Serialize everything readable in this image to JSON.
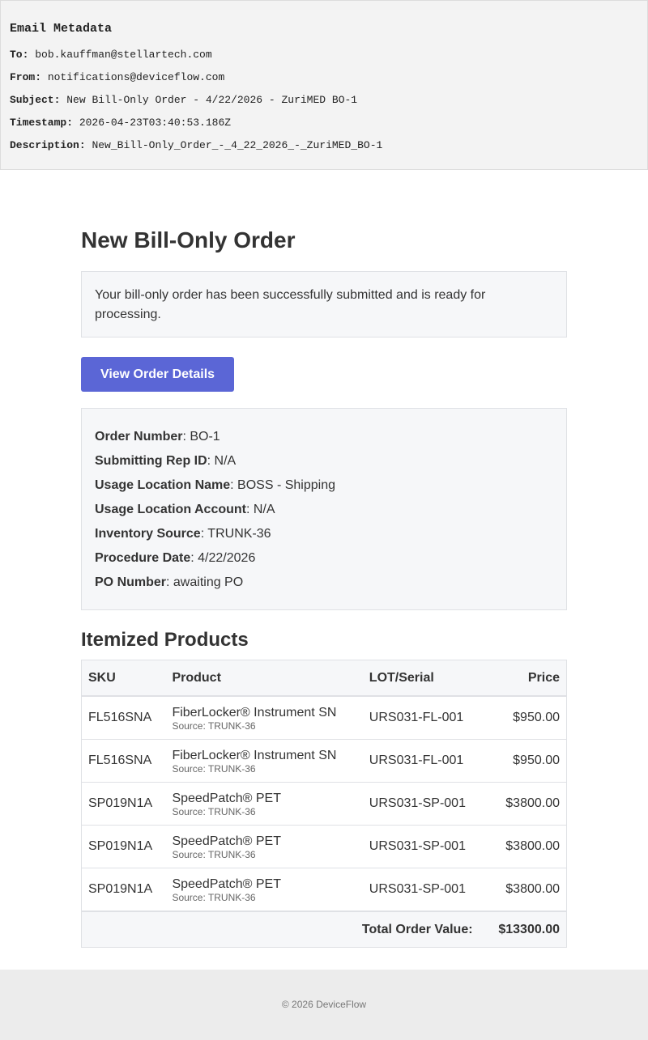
{
  "metadata": {
    "title": "Email Metadata",
    "to_label": "To:",
    "to": "bob.kauffman@stellartech.com",
    "from_label": "From:",
    "from": "notifications@deviceflow.com",
    "subject_label": "Subject:",
    "subject": "New Bill-Only Order - 4/22/2026 - ZuriMED BO-1",
    "timestamp_label": "Timestamp:",
    "timestamp": "2026-04-23T03:40:53.186Z",
    "description_label": "Description:",
    "description": "New_Bill-Only_Order_-_4_22_2026_-_ZuriMED_BO-1"
  },
  "email": {
    "heading": "New Bill-Only Order",
    "notice": "Your bill-only order has been successfully submitted and is ready for processing.",
    "button_label": "View Order Details",
    "details": [
      {
        "label": "Order Number",
        "value": ": BO-1"
      },
      {
        "label": "Submitting Rep ID",
        "value": ": N/A"
      },
      {
        "label": "Usage Location Name",
        "value": ": BOSS - Shipping"
      },
      {
        "label": "Usage Location Account",
        "value": ": N/A"
      },
      {
        "label": "Inventory Source",
        "value": ": TRUNK-36"
      },
      {
        "label": "Procedure Date",
        "value": ": 4/22/2026"
      },
      {
        "label": "PO Number",
        "value": ": awaiting PO"
      }
    ],
    "products_heading": "Itemized Products",
    "table": {
      "headers": [
        "SKU",
        "Product",
        "LOT/Serial",
        "Price"
      ],
      "rows": [
        {
          "sku": "FL516SNA",
          "product": "FiberLocker® Instrument SN",
          "source": "Source: TRUNK-36",
          "lot": "URS031-FL-001",
          "price": "$950.00"
        },
        {
          "sku": "FL516SNA",
          "product": "FiberLocker® Instrument SN",
          "source": "Source: TRUNK-36",
          "lot": "URS031-FL-001",
          "price": "$950.00"
        },
        {
          "sku": "SP019N1A",
          "product": "SpeedPatch® PET",
          "source": "Source: TRUNK-36",
          "lot": "URS031-SP-001",
          "price": "$3800.00"
        },
        {
          "sku": "SP019N1A",
          "product": "SpeedPatch® PET",
          "source": "Source: TRUNK-36",
          "lot": "URS031-SP-001",
          "price": "$3800.00"
        },
        {
          "sku": "SP019N1A",
          "product": "SpeedPatch® PET",
          "source": "Source: TRUNK-36",
          "lot": "URS031-SP-001",
          "price": "$3800.00"
        }
      ],
      "total_label": "Total Order Value:",
      "total_value": "$13300.00"
    }
  },
  "footer": {
    "copyright": "© 2026 DeviceFlow"
  },
  "colors": {
    "button": "#5b66d6",
    "panel_bg": "#f6f7f9",
    "metadata_bg": "#f3f3f3",
    "footer_bg": "#ececec"
  }
}
